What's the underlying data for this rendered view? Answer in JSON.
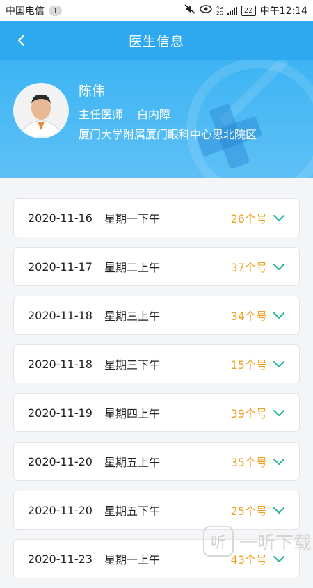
{
  "status_bar": {
    "carrier": "中国电信",
    "notification_count": "1",
    "network_top": "4G",
    "network_bottom": "2G",
    "battery": "22",
    "time": "中午12:14"
  },
  "header": {
    "title": "医生信息"
  },
  "doctor": {
    "name": "陈伟",
    "title": "主任医师",
    "department": "白内障",
    "hospital": "厦门大学附属厦门眼科中心思北院区"
  },
  "schedule": [
    {
      "date": "2020-11-16",
      "session": "星期一下午",
      "count": "26个号"
    },
    {
      "date": "2020-11-17",
      "session": "星期二上午",
      "count": "37个号"
    },
    {
      "date": "2020-11-18",
      "session": "星期三上午",
      "count": "34个号"
    },
    {
      "date": "2020-11-18",
      "session": "星期三下午",
      "count": "15个号"
    },
    {
      "date": "2020-11-19",
      "session": "星期四上午",
      "count": "39个号"
    },
    {
      "date": "2020-11-20",
      "session": "星期五上午",
      "count": "35个号"
    },
    {
      "date": "2020-11-20",
      "session": "星期五下午",
      "count": "25个号"
    },
    {
      "date": "2020-11-23",
      "session": "星期一上午",
      "count": "43个号"
    }
  ],
  "watermark": {
    "icon": "听",
    "text": "一听下载"
  },
  "colors": {
    "header": "#2ea8ef",
    "count": "#f0a020",
    "chevron": "#22b3a0"
  }
}
